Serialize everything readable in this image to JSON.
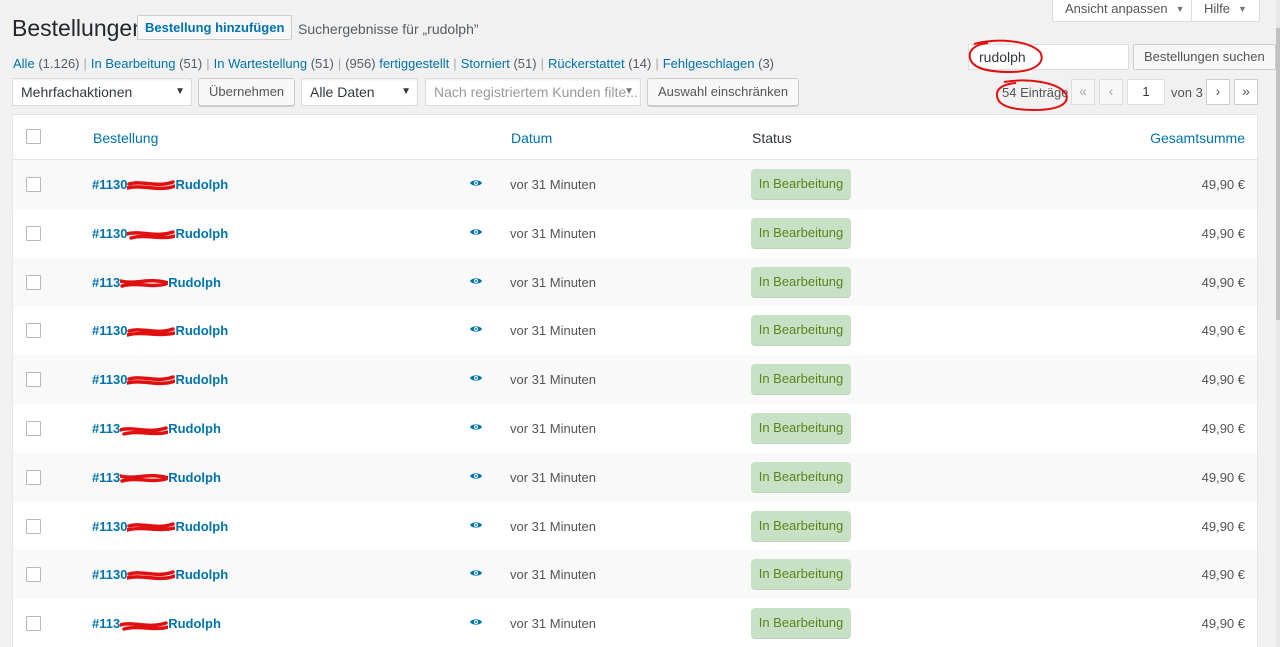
{
  "header": {
    "screen_options_label": "Ansicht anpassen",
    "help_label": "Hilfe",
    "title": "Bestellungen",
    "add_button": "Bestellung hinzufügen",
    "subtitle": "Suchergebnisse für „rudolph”"
  },
  "filters": [
    {
      "label": "Alle",
      "count": "(1.126)"
    },
    {
      "label": "In Bearbeitung",
      "count": "(51)"
    },
    {
      "label": "In Wartestellung",
      "count": "(51)"
    },
    {
      "label": "fertiggestellt",
      "count": "(956)",
      "count_first": true
    },
    {
      "label": "Storniert",
      "count": "(51)"
    },
    {
      "label": "Rückerstattet",
      "count": "(14)"
    },
    {
      "label": "Fehlgeschlagen",
      "count": "(3)"
    }
  ],
  "search": {
    "value": "rudolph",
    "button": "Bestellungen suchen"
  },
  "toolbar": {
    "bulk_actions": "Mehrfachaktionen",
    "apply": "Übernehmen",
    "dates": "Alle Daten",
    "customer_placeholder": "Nach registriertem Kunden filte...",
    "filter_button": "Auswahl einschränken"
  },
  "pagination": {
    "items": "54 Einträge",
    "first": "«",
    "prev": "‹",
    "current": "1",
    "of": "von 3",
    "next": "›",
    "last": "»"
  },
  "table": {
    "columns": {
      "order": "Bestellung",
      "date": "Datum",
      "status": "Status",
      "total": "Gesamtsumme"
    },
    "rows": [
      {
        "order_prefix": "#1130",
        "order_name": "Rudolph",
        "date": "vor 31 Minuten",
        "status": "In Bearbeitung",
        "total": "49,90 €"
      },
      {
        "order_prefix": "#1130",
        "order_name": "Rudolph",
        "date": "vor 31 Minuten",
        "status": "In Bearbeitung",
        "total": "49,90 €"
      },
      {
        "order_prefix": "#113",
        "order_name": "Rudolph",
        "date": "vor 31 Minuten",
        "status": "In Bearbeitung",
        "total": "49,90 €"
      },
      {
        "order_prefix": "#1130",
        "order_name": "Rudolph",
        "date": "vor 31 Minuten",
        "status": "In Bearbeitung",
        "total": "49,90 €"
      },
      {
        "order_prefix": "#1130",
        "order_name": "Rudolph",
        "date": "vor 31 Minuten",
        "status": "In Bearbeitung",
        "total": "49,90 €"
      },
      {
        "order_prefix": "#113",
        "order_name": "Rudolph",
        "date": "vor 31 Minuten",
        "status": "In Bearbeitung",
        "total": "49,90 €"
      },
      {
        "order_prefix": "#113",
        "order_name": "Rudolph",
        "date": "vor 31 Minuten",
        "status": "In Bearbeitung",
        "total": "49,90 €"
      },
      {
        "order_prefix": "#1130",
        "order_name": "Rudolph",
        "date": "vor 31 Minuten",
        "status": "In Bearbeitung",
        "total": "49,90 €"
      },
      {
        "order_prefix": "#1130",
        "order_name": "Rudolph",
        "date": "vor 31 Minuten",
        "status": "In Bearbeitung",
        "total": "49,90 €"
      },
      {
        "order_prefix": "#113",
        "order_name": "Rudolph",
        "date": "vor 31 Minuten",
        "status": "In Bearbeitung",
        "total": "49,90 €"
      }
    ]
  },
  "colors": {
    "link": "#0073aa",
    "status_bg": "#c6e1c6",
    "status_text": "#5b841b",
    "annotation": "#e01010"
  }
}
